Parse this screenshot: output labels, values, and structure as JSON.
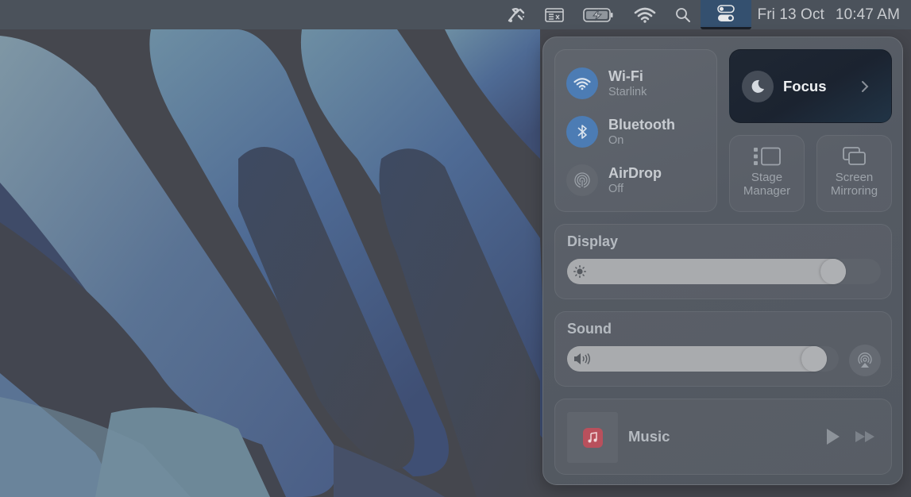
{
  "menubar": {
    "icons": [
      {
        "name": "tools-icon",
        "label": "Utilities"
      },
      {
        "name": "window-icon",
        "label": "Window manager"
      },
      {
        "name": "battery-charging-icon",
        "label": "Battery"
      },
      {
        "name": "wifi-icon",
        "label": "Wi-Fi"
      },
      {
        "name": "search-icon",
        "label": "Spotlight"
      },
      {
        "name": "control-center-icon",
        "label": "Control Centre"
      }
    ],
    "date": "Fri 13 Oct",
    "time": "10:47 AM"
  },
  "control_center": {
    "connectivity": [
      {
        "title": "Wi-Fi",
        "subtitle": "Starlink",
        "state": "on",
        "icon": "wifi-icon"
      },
      {
        "title": "Bluetooth",
        "subtitle": "On",
        "state": "on",
        "icon": "bluetooth-icon"
      },
      {
        "title": "AirDrop",
        "subtitle": "Off",
        "state": "off",
        "icon": "airdrop-icon"
      }
    ],
    "focus": {
      "label": "Focus",
      "icon": "moon-icon"
    },
    "stage_manager": {
      "label_line1": "Stage",
      "label_line2": "Manager"
    },
    "screen_mirroring": {
      "label_line1": "Screen",
      "label_line2": "Mirroring"
    },
    "display": {
      "label": "Display",
      "brightness": 0.88
    },
    "sound": {
      "label": "Sound",
      "volume": 0.95
    },
    "now_playing": {
      "app": "Music"
    }
  },
  "colors": {
    "accent_on": "#4c7cb4",
    "focus_tile": "#1f2733",
    "music_app": "#b9505c"
  }
}
